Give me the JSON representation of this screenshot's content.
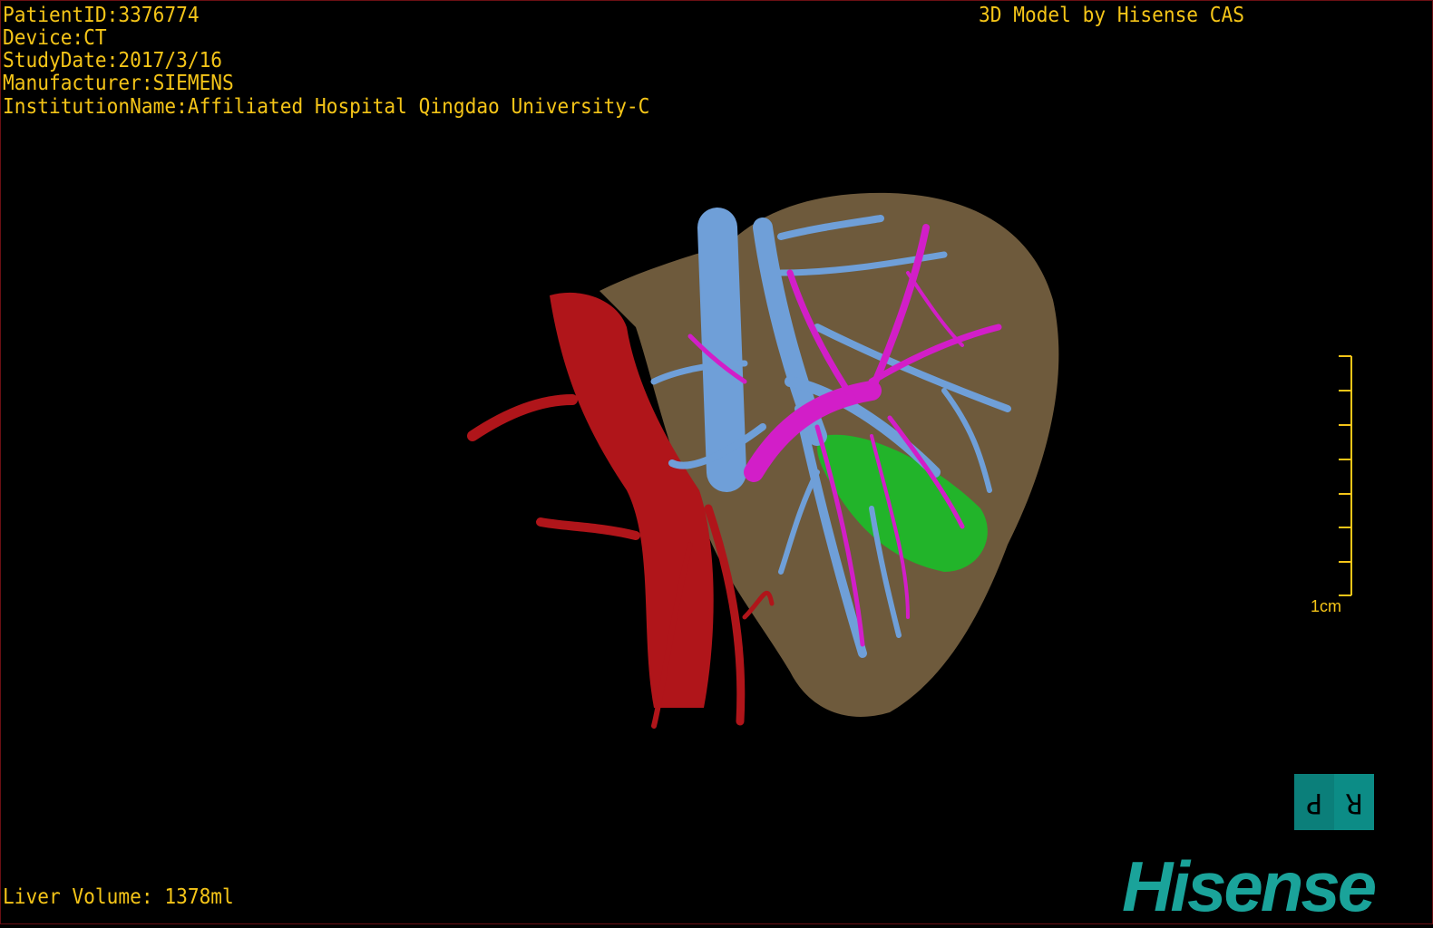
{
  "header": {
    "patient_id": "PatientID:3376774",
    "device": "Device:CT",
    "study_date": "StudyDate:2017/3/16",
    "manufacturer": "Manufacturer:SIEMENS",
    "institution": "InstitutionName:Affiliated Hospital Qingdao University-C",
    "model_credit": "3D Model by Hisense CAS"
  },
  "footer": {
    "liver_volume": "Liver Volume: 1378ml"
  },
  "scale_bar": {
    "label": "1cm"
  },
  "orientation_cube": {
    "left_face": "P",
    "right_face": "R"
  },
  "logo": {
    "text": "Hisense"
  },
  "colors": {
    "text": "#f5c518",
    "liver": "#6e5a3c",
    "artery": "#b0151a",
    "portal_vein": "#6f9fd8",
    "hepatic_vein": "#d21ec8",
    "gallbladder": "#22b42a",
    "logo": "#1aa39a"
  }
}
